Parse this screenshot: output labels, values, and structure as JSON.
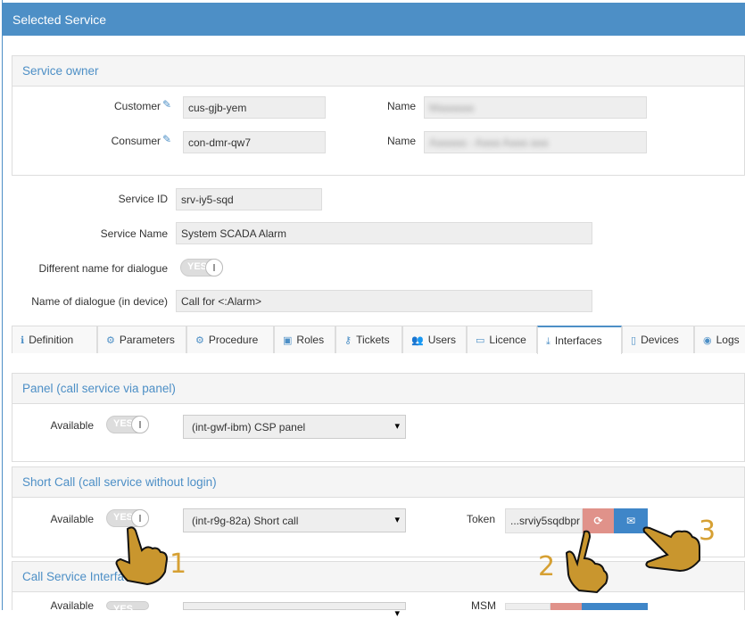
{
  "header": {
    "title": "Selected Service"
  },
  "owner": {
    "title": "Service owner",
    "customer_label": "Customer",
    "customer_value": "cus-gjb-yem",
    "consumer_label": "Consumer",
    "consumer_value": "con-dmr-qw7",
    "name_label": "Name",
    "name1_value": "Maaaaaa",
    "name2_value": "Aaaaaa - Aaaa Aaaa aaa"
  },
  "service": {
    "id_label": "Service ID",
    "id_value": "srv-iy5-sqd",
    "name_label": "Service Name",
    "name_value": "System SCADA Alarm",
    "diff_label": "Different name for dialogue",
    "diff_toggle": "YES",
    "dialog_label": "Name of dialogue (in device)",
    "dialog_value": "Call for <:Alarm>"
  },
  "tabs": [
    {
      "label": "Definition",
      "icon": "info-circle-icon",
      "g": "ℹ"
    },
    {
      "label": "Parameters",
      "icon": "gear-icon",
      "g": "⚙"
    },
    {
      "label": "Procedure",
      "icon": "gears-icon",
      "g": "⚙"
    },
    {
      "label": "Roles",
      "icon": "briefcase-icon",
      "g": "▣"
    },
    {
      "label": "Tickets",
      "icon": "key-icon",
      "g": "⚷"
    },
    {
      "label": "Users",
      "icon": "users-icon",
      "g": "👥"
    },
    {
      "label": "Licence",
      "icon": "credit-card-icon",
      "g": "▭"
    },
    {
      "label": "Interfaces",
      "icon": "download-icon",
      "g": "⤓",
      "active": true
    },
    {
      "label": "Devices",
      "icon": "mobile-icon",
      "g": "▯"
    },
    {
      "label": "Logs",
      "icon": "eye-icon",
      "g": "◉"
    }
  ],
  "panel": {
    "title": "Panel (call service via panel)",
    "available_label": "Available",
    "toggle": "YES",
    "select_value": "(int-gwf-ibm) CSP panel"
  },
  "shortcall": {
    "title": "Short Call (call service without login)",
    "available_label": "Available",
    "toggle": "YES",
    "select_value": "(int-r9g-82a) Short call",
    "token_label": "Token",
    "token_value": "...srviy5sqdbpr"
  },
  "csi": {
    "title": "Call Service Interface",
    "available_label": "Available",
    "toggle": "YES",
    "msm_label": "MSM"
  },
  "annotations": [
    "1",
    "2",
    "3"
  ],
  "colors": {
    "header": "#4d8fc6",
    "refresh_button": "#e0928a",
    "mail_button": "#3f86c8",
    "hand": "#c9962e"
  }
}
